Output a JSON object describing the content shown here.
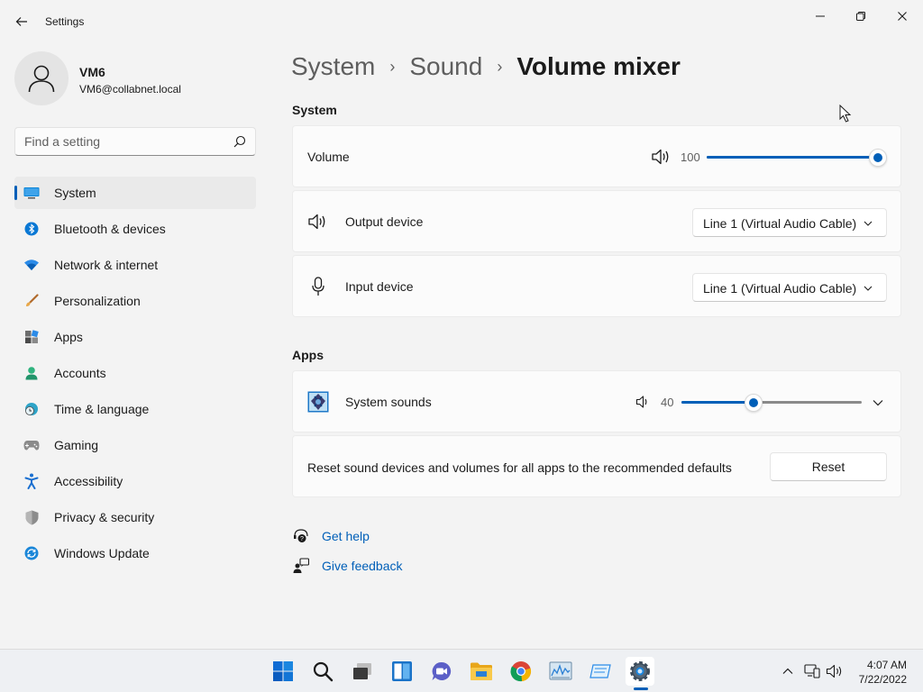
{
  "window": {
    "title": "Settings"
  },
  "profile": {
    "name": "VM6",
    "email": "VM6@collabnet.local"
  },
  "search": {
    "placeholder": "Find a setting"
  },
  "nav": {
    "items": [
      {
        "label": "System",
        "icon": "system-icon",
        "active": true
      },
      {
        "label": "Bluetooth & devices",
        "icon": "bluetooth-icon"
      },
      {
        "label": "Network & internet",
        "icon": "wifi-icon"
      },
      {
        "label": "Personalization",
        "icon": "brush-icon"
      },
      {
        "label": "Apps",
        "icon": "apps-icon"
      },
      {
        "label": "Accounts",
        "icon": "person-icon"
      },
      {
        "label": "Time & language",
        "icon": "globe-clock-icon"
      },
      {
        "label": "Gaming",
        "icon": "gamepad-icon"
      },
      {
        "label": "Accessibility",
        "icon": "accessibility-icon"
      },
      {
        "label": "Privacy & security",
        "icon": "shield-icon"
      },
      {
        "label": "Windows Update",
        "icon": "update-icon"
      }
    ]
  },
  "breadcrumb": {
    "items": [
      "System",
      "Sound",
      "Volume mixer"
    ],
    "separator": "›"
  },
  "system_section": {
    "title": "System",
    "volume": {
      "label": "Volume",
      "value": 100,
      "value_text": "100"
    },
    "output": {
      "label": "Output device",
      "selected": "Line 1 (Virtual Audio Cable)"
    },
    "input": {
      "label": "Input device",
      "selected": "Line 1 (Virtual Audio Cable)"
    }
  },
  "apps_section": {
    "title": "Apps",
    "system_sounds": {
      "label": "System sounds",
      "value": 40,
      "value_text": "40"
    },
    "reset": {
      "text": "Reset sound devices and volumes for all apps to the recommended defaults",
      "button_label": "Reset"
    }
  },
  "help": {
    "get_help": "Get help",
    "give_feedback": "Give feedback"
  },
  "taskbar": {
    "time": "4:07 AM",
    "date": "7/22/2022"
  },
  "colors": {
    "accent": "#005fb8",
    "background": "#f3f3f3",
    "card": "#fbfbfb"
  }
}
